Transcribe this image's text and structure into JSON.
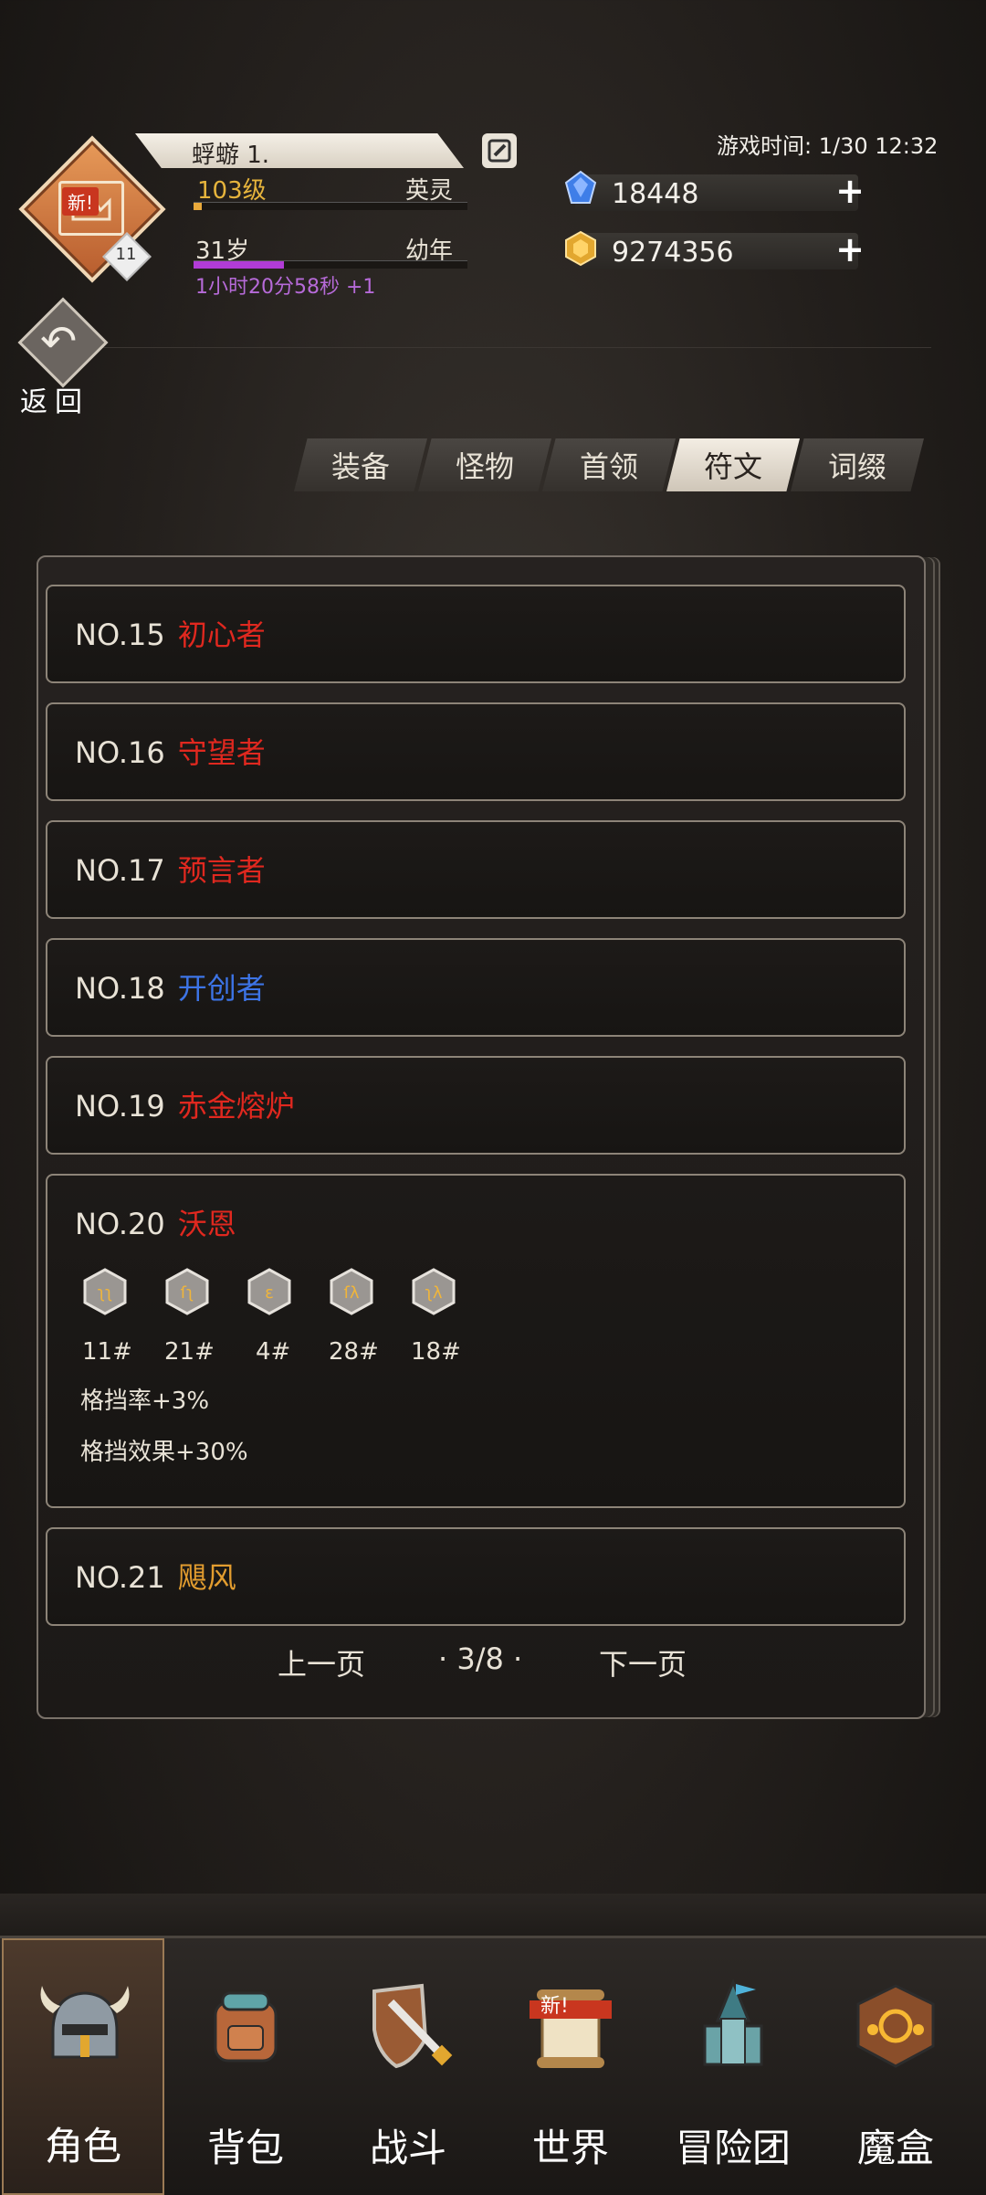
{
  "header": {
    "player_name": "蜉蝣 1.",
    "level_text": "103级",
    "rank_text": "英灵",
    "level_progress": 0.03,
    "age_text": "31岁",
    "age_stage": "幼年",
    "age_progress": 0.33,
    "age_timer": "1小时20分58秒 +1",
    "avatar_badge": "新!",
    "avatar_level": "11",
    "game_time": "游戏时间: 1/30 12:32",
    "gems": "18448",
    "gold": "9274356",
    "back_label": "返回"
  },
  "tabs": [
    {
      "label": "装备",
      "active": false
    },
    {
      "label": "怪物",
      "active": false
    },
    {
      "label": "首领",
      "active": false
    },
    {
      "label": "符文",
      "active": true
    },
    {
      "label": "词缀",
      "active": false
    }
  ],
  "list": [
    {
      "no": "NO.15",
      "name": "初心者",
      "color": "#e0281f"
    },
    {
      "no": "NO.16",
      "name": "守望者",
      "color": "#e0281f"
    },
    {
      "no": "NO.17",
      "name": "预言者",
      "color": "#e0281f"
    },
    {
      "no": "NO.18",
      "name": "开创者",
      "color": "#3d74e6"
    },
    {
      "no": "NO.19",
      "name": "赤金熔炉",
      "color": "#e0281f"
    },
    {
      "no": "NO.20",
      "name": "沃恩",
      "color": "#e0281f",
      "runes": [
        "11#",
        "21#",
        "4#",
        "28#",
        "18#"
      ],
      "stats": [
        "格挡率+3%",
        "格挡效果+30%"
      ]
    },
    {
      "no": "NO.21",
      "name": "飓风",
      "color": "#e39d2f"
    }
  ],
  "pager": {
    "prev": "上一页",
    "page": "· 3/8 ·",
    "next": "下一页"
  },
  "nav": [
    {
      "label": "角色",
      "icon": "helmet-icon",
      "active": true
    },
    {
      "label": "背包",
      "icon": "backpack-icon",
      "active": false
    },
    {
      "label": "战斗",
      "icon": "sword-shield-icon",
      "active": false
    },
    {
      "label": "世界",
      "icon": "scroll-icon",
      "active": false,
      "badge": "新!"
    },
    {
      "label": "冒险团",
      "icon": "castle-icon",
      "active": false
    },
    {
      "label": "魔盒",
      "icon": "magic-box-icon",
      "active": false
    }
  ]
}
